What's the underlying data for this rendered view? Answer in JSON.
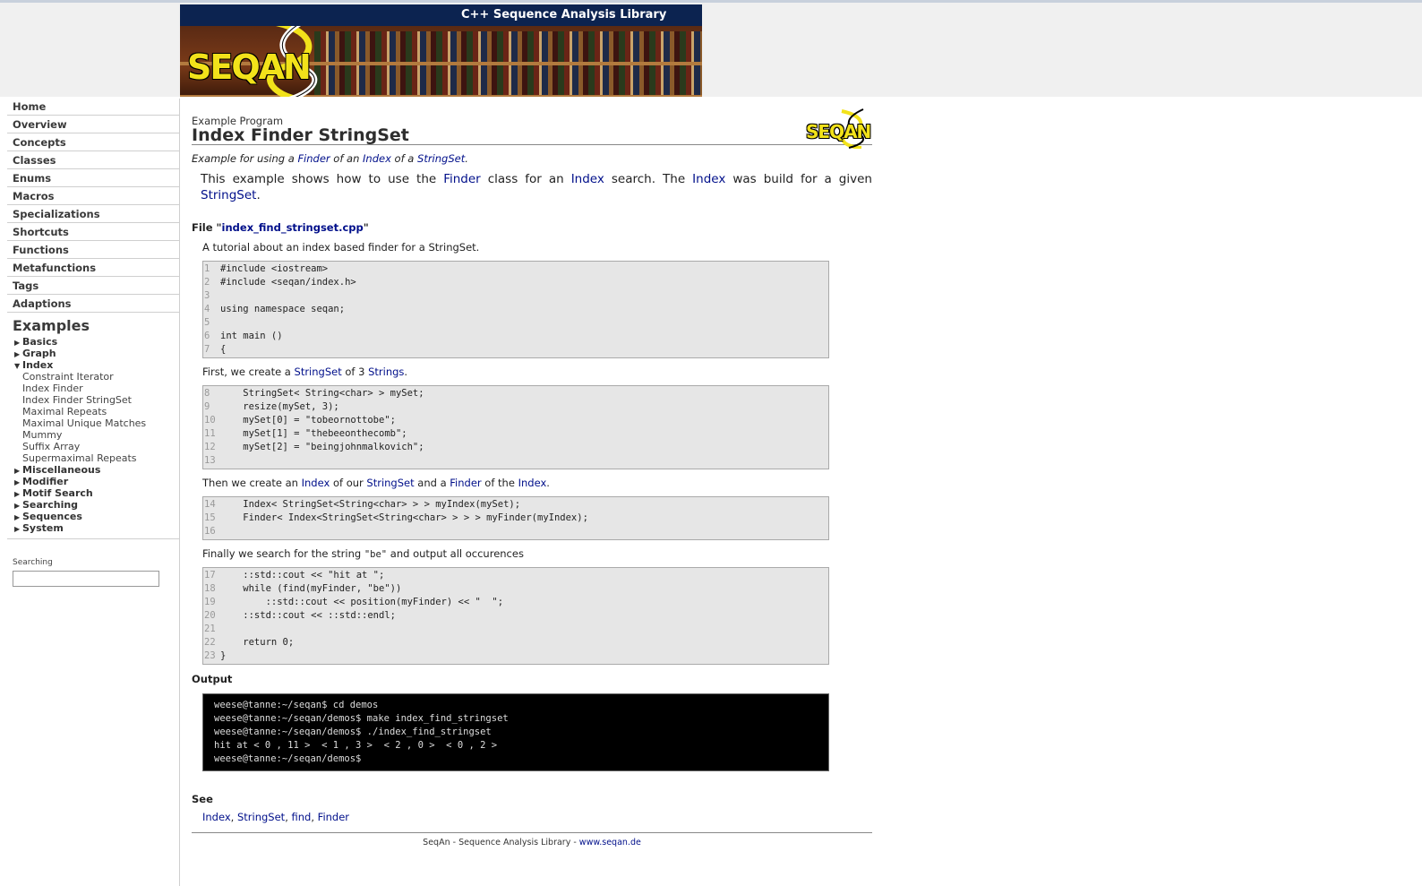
{
  "banner": {
    "title": "C++ Sequence Analysis Library",
    "logo_text": "SEQAN"
  },
  "nav": [
    "Home",
    "Overview",
    "Concepts",
    "Classes",
    "Enums",
    "Macros",
    "Specializations",
    "Shortcuts",
    "Functions",
    "Metafunctions",
    "Tags",
    "Adaptions"
  ],
  "examples": {
    "heading": "Examples",
    "cats_before": [
      "Basics",
      "Graph"
    ],
    "open_cat": "Index",
    "open_items": [
      "Constraint Iterator",
      "Index Finder",
      "Index Finder StringSet",
      "Maximal Repeats",
      "Maximal Unique Matches",
      "Mummy",
      "Suffix Array",
      "Supermaximal Repeats"
    ],
    "cats_after": [
      "Miscellaneous",
      "Modifier",
      "Motif Search",
      "Searching",
      "Sequences",
      "System"
    ]
  },
  "search": {
    "label": "Searching",
    "value": ""
  },
  "page": {
    "kind": "Example Program",
    "title": "Index Finder StringSet",
    "logo_small": "SEQAN",
    "subtitle": {
      "t1": "Example for using a ",
      "l1": "Finder",
      "t2": " of an ",
      "l2": "Index",
      "t3": " of a ",
      "l3": "StringSet",
      "t4": "."
    },
    "desc": {
      "t1": "This example shows how to use the ",
      "l1": "Finder",
      "t2": " class for an ",
      "l2": "Index",
      "t3": " search. The ",
      "l3": "Index",
      "t4": " was build for a given ",
      "l4": "StringSet",
      "t5": "."
    },
    "file": {
      "prefix": "File \"",
      "name": "index_find_stringset.cpp",
      "suffix": "\""
    },
    "tutorial": "A tutorial about an index based finder for a StringSet.",
    "blocks": [
      {
        "lines": [
          {
            "n": "1",
            "code": "#include <iostream>"
          },
          {
            "n": "2",
            "code": "#include <seqan/index.h>"
          },
          {
            "n": "3",
            "code": ""
          },
          {
            "n": "4",
            "code": "using namespace seqan;"
          },
          {
            "n": "5",
            "code": ""
          },
          {
            "n": "6",
            "code": "int main ()"
          },
          {
            "n": "7",
            "code": "{"
          }
        ]
      },
      {
        "lines": [
          {
            "n": "8",
            "code": "    StringSet< String<char> > mySet;"
          },
          {
            "n": "9",
            "code": "    resize(mySet, 3);"
          },
          {
            "n": "10",
            "code": "    mySet[0] = \"tobeornottobe\";"
          },
          {
            "n": "11",
            "code": "    mySet[1] = \"thebeeonthecomb\";"
          },
          {
            "n": "12",
            "code": "    mySet[2] = \"beingjohnmalkovich\";"
          },
          {
            "n": "13",
            "code": ""
          }
        ]
      },
      {
        "lines": [
          {
            "n": "14",
            "code": "    Index< StringSet<String<char> > > myIndex(mySet);"
          },
          {
            "n": "15",
            "code": "    Finder< Index<StringSet<String<char> > > > myFinder(myIndex);"
          },
          {
            "n": "16",
            "code": ""
          }
        ]
      },
      {
        "lines": [
          {
            "n": "17",
            "code": "    ::std::cout << \"hit at \";"
          },
          {
            "n": "18",
            "code": "    while (find(myFinder, \"be\"))"
          },
          {
            "n": "19",
            "code": "        ::std::cout << position(myFinder) << \"  \";"
          },
          {
            "n": "20",
            "code": "    ::std::cout << ::std::endl;"
          },
          {
            "n": "21",
            "code": ""
          },
          {
            "n": "22",
            "code": "    return 0;"
          },
          {
            "n": "23",
            "code": "}"
          }
        ]
      }
    ],
    "para1": {
      "t1": "First, we create a ",
      "l1": "StringSet",
      "t2": " of 3 ",
      "l2": "Strings",
      "t3": "."
    },
    "para2": {
      "t1": "Then we create an ",
      "l1": "Index",
      "t2": " of our ",
      "l2": "StringSet",
      "t3": " and a ",
      "l3": "Finder",
      "t4": " of the ",
      "l4": "Index",
      "t5": "."
    },
    "para3": {
      "t1": "Finally we search for the string ",
      "code": "\"be\"",
      "t2": " and output all occurences"
    },
    "output_heading": "Output",
    "output": [
      "weese@tanne:~/seqan$ cd demos",
      "weese@tanne:~/seqan/demos$ make index_find_stringset",
      "weese@tanne:~/seqan/demos$ ./index_find_stringset",
      "hit at < 0 , 11 >  < 1 , 3 >  < 2 , 0 >  < 0 , 2 >",
      "weese@tanne:~/seqan/demos$"
    ],
    "see_heading": "See",
    "see": [
      "Index",
      "StringSet",
      "find",
      "Finder"
    ],
    "footer": {
      "text": "SeqAn - Sequence Analysis Library - ",
      "link": "www.seqan.de"
    }
  }
}
